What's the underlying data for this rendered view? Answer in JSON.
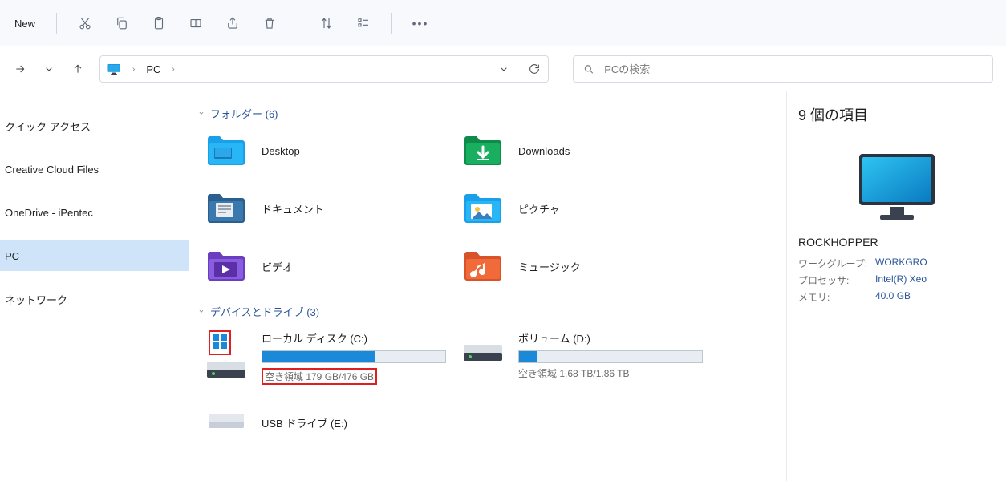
{
  "toolbar": {
    "new_label": "New"
  },
  "address": {
    "location": "PC"
  },
  "search": {
    "placeholder": "PCの検索"
  },
  "sidebar": {
    "items": [
      {
        "label": "クイック アクセス",
        "selected": false
      },
      {
        "label": "Creative Cloud Files",
        "selected": false
      },
      {
        "label": "OneDrive - iPentec",
        "selected": false
      },
      {
        "label": "PC",
        "selected": true
      },
      {
        "label": "ネットワーク",
        "selected": false
      }
    ]
  },
  "groups": {
    "folders": {
      "header": "フォルダー (6)",
      "items": [
        {
          "label": "Desktop",
          "icon": "desktop"
        },
        {
          "label": "Downloads",
          "icon": "downloads"
        },
        {
          "label": "ドキュメント",
          "icon": "documents"
        },
        {
          "label": "ピクチャ",
          "icon": "pictures"
        },
        {
          "label": "ビデオ",
          "icon": "videos"
        },
        {
          "label": "ミュージック",
          "icon": "music"
        }
      ]
    },
    "drives": {
      "header": "デバイスとドライブ (3)",
      "items": [
        {
          "name": "ローカル ディスク (C:)",
          "free": "空き領域 179 GB/476 GB",
          "fill_pct": 62,
          "has_bar": true,
          "highlight": true,
          "os": true
        },
        {
          "name": "ボリューム (D:)",
          "free": "空き領域 1.68 TB/1.86 TB",
          "fill_pct": 10,
          "has_bar": true,
          "highlight": false,
          "os": false
        },
        {
          "name": "USB ドライブ (E:)",
          "free": "",
          "fill_pct": 0,
          "has_bar": false,
          "highlight": false,
          "os": false
        }
      ]
    }
  },
  "details": {
    "title": "9 個の項目",
    "computer_name": "ROCKHOPPER",
    "rows": [
      {
        "k": "ワークグループ:",
        "v": "WORKGRO"
      },
      {
        "k": "プロセッサ:",
        "v": "Intel(R) Xeo"
      },
      {
        "k": "メモリ:",
        "v": "40.0 GB"
      }
    ]
  }
}
